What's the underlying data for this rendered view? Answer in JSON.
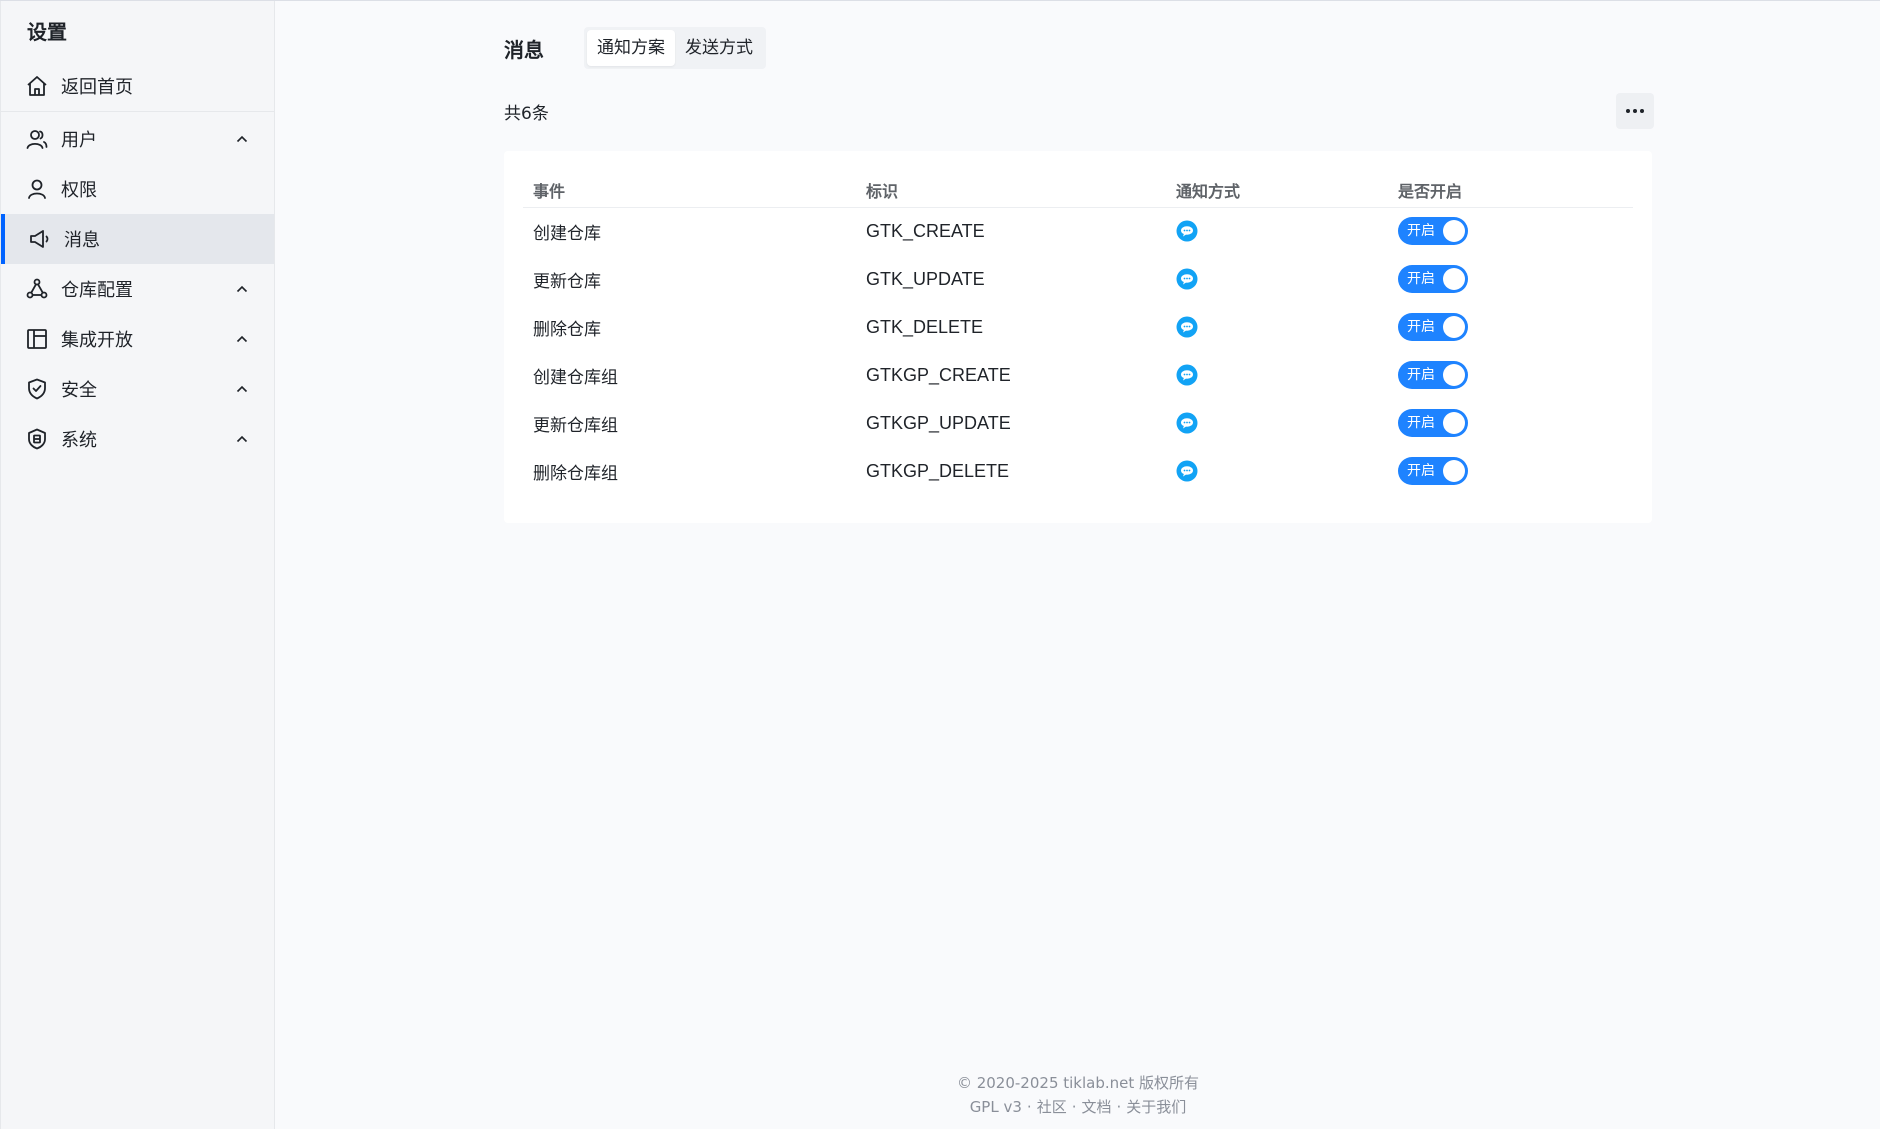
{
  "sidebar": {
    "title": "设置",
    "items": [
      {
        "label": "返回首页"
      },
      {
        "label": "用户"
      },
      {
        "label": "权限"
      },
      {
        "label": "消息"
      },
      {
        "label": "仓库配置"
      },
      {
        "label": "集成开放"
      },
      {
        "label": "安全"
      },
      {
        "label": "系统"
      }
    ]
  },
  "header": {
    "title": "消息",
    "tabs": [
      {
        "label": "通知方案",
        "active": true
      },
      {
        "label": "发送方式",
        "active": false
      }
    ]
  },
  "list": {
    "count_text": "共6条",
    "columns": [
      "事件",
      "标识",
      "通知方式",
      "是否开启"
    ],
    "rows": [
      {
        "event": "创建仓库",
        "code": "GTK_CREATE",
        "method": "message-icon",
        "enabled": "开启"
      },
      {
        "event": "更新仓库",
        "code": "GTK_UPDATE",
        "method": "message-icon",
        "enabled": "开启"
      },
      {
        "event": "删除仓库",
        "code": "GTK_DELETE",
        "method": "message-icon",
        "enabled": "开启"
      },
      {
        "event": "创建仓库组",
        "code": "GTKGP_CREATE",
        "method": "message-icon",
        "enabled": "开启"
      },
      {
        "event": "更新仓库组",
        "code": "GTKGP_UPDATE",
        "method": "message-icon",
        "enabled": "开启"
      },
      {
        "event": "删除仓库组",
        "code": "GTKGP_DELETE",
        "method": "message-icon",
        "enabled": "开启"
      }
    ]
  },
  "footer": {
    "copyright": "© 2020-2025 tiklab.net 版权所有",
    "license": "GPL v3",
    "dot": "·",
    "community": "社区",
    "docs": "文档",
    "about": "关于我们"
  },
  "colors": {
    "accent": "#0063ff",
    "switch_on": "#1e83ff",
    "message_icon": "#12a3f5"
  }
}
